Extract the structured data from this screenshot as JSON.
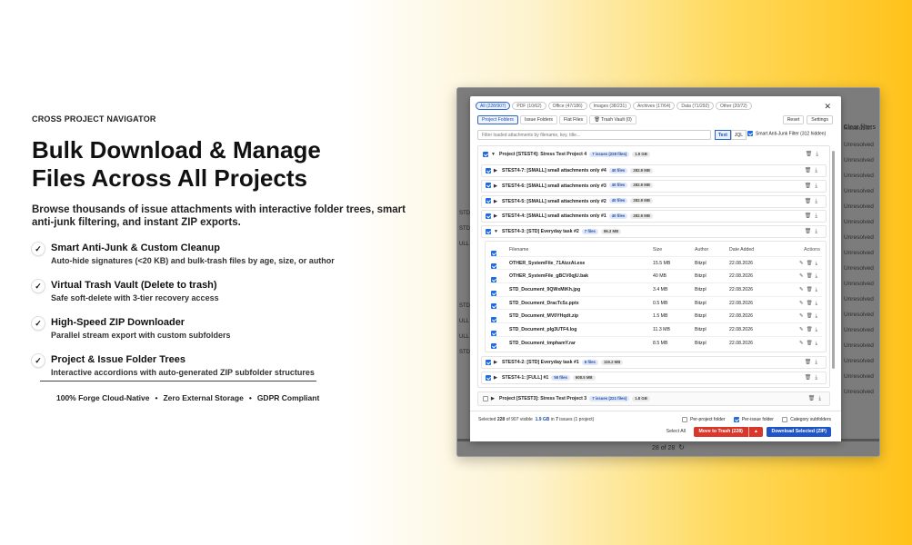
{
  "hero": {
    "eyebrow": "CROSS PROJECT NAVIGATOR",
    "headline_1": "Bulk Download & Manage",
    "headline_2": "Files Across All Projects",
    "subhead": "Browse thousands of issue attachments with interactive folder trees, smart anti-junk filtering, and instant ZIP exports.",
    "features": [
      {
        "title": "Smart Anti-Junk & Custom Cleanup",
        "desc": "Auto-hide signatures (<20 KB) and bulk-trash files by age, size, or author"
      },
      {
        "title": "Virtual Trash Vault (Delete to trash)",
        "desc": "Safe soft-delete with 3-tier recovery access"
      },
      {
        "title": "High-Speed ZIP Downloader",
        "desc": "Parallel stream export with custom subfolders"
      },
      {
        "title": "Project & Issue Folder Trees",
        "desc": "Interactive accordions with auto-generated ZIP subfolder structures"
      }
    ],
    "footer_items": [
      "100% Forge Cloud-Native",
      "Zero External Storage",
      "GDPR Compliant"
    ]
  },
  "background_app": {
    "clear_filters": "Clear filters",
    "resolution_header": "Resolution",
    "rows": [
      "Unresolved",
      "Unresolved",
      "Unresolved",
      "Unresolved",
      "Unresolved",
      "Unresolved",
      "Unresolved",
      "Unresolved",
      "Unresolved",
      "Unresolved",
      "Unresolved",
      "Unresolved",
      "Unresolved",
      "Unresolved",
      "Unresolved",
      "Unresolved",
      "Unresolved"
    ],
    "left_rows": [
      "J",
      "",
      "",
      "",
      "",
      "",
      "STD",
      "STD",
      "ULL",
      "",
      "",
      "",
      "STD",
      "ULL",
      "ULL",
      "STD",
      "",
      "STD"
    ],
    "pager": "28 of 28"
  },
  "modal": {
    "type_filters": [
      {
        "label": "All (228/907)",
        "active": true
      },
      {
        "label": "PDF (10/62)",
        "active": false
      },
      {
        "label": "Office (47/186)",
        "active": false
      },
      {
        "label": "Images (38/231)",
        "active": false
      },
      {
        "label": "Archives (17/64)",
        "active": false
      },
      {
        "label": "Data (71/292)",
        "active": false
      },
      {
        "label": "Other (20/72)",
        "active": false
      }
    ],
    "view_tabs": [
      {
        "label": "Project Folders",
        "active": true
      },
      {
        "label": "Issue Folders",
        "active": false
      },
      {
        "label": "Flat Files",
        "active": false
      },
      {
        "label": "Trash Vault (0)",
        "active": false
      }
    ],
    "reset_label": "Reset",
    "settings_label": "Settings",
    "filter_placeholder": "Filter loaded attachments by filename, key, title...",
    "mode_text": "Text",
    "mode_jql": "JQL",
    "antijunk_label": "Smart Anti-Junk Filter (312 hidden)",
    "project_1": {
      "title": "Project [STEST4]: Stress Test Project 4",
      "issues_badge": "7 issues (228 files)",
      "size_badge": "1.9 GB"
    },
    "issues": [
      {
        "title": "STEST4-7: [SMALL] small attachments only #4",
        "files": "40 files",
        "size": "282.9 MB",
        "open": false
      },
      {
        "title": "STEST4-6: [SMALL] small attachments only #3",
        "files": "40 files",
        "size": "282.9 MB",
        "open": false
      },
      {
        "title": "STEST4-5: [SMALL] small attachments only #2",
        "files": "40 files",
        "size": "282.9 MB",
        "open": false
      },
      {
        "title": "STEST4-4: [SMALL] small attachments only #1",
        "files": "40 files",
        "size": "282.9 MB",
        "open": false
      },
      {
        "title": "STEST4-3: [STD] Everyday task #2",
        "files": "7 files",
        "size": "86.3 MB",
        "open": true
      }
    ],
    "file_columns": {
      "name": "Filename",
      "size": "Size",
      "author": "Author",
      "date": "Date Added",
      "actions": "Actions"
    },
    "files": [
      {
        "name": "OTHER_SystemFile_71AtzzAt.exe",
        "size": "15.5 MB",
        "author": "Bitzpl",
        "date": "22.08.2026"
      },
      {
        "name": "OTHER_SystemFile_gBCV0qjU.bak",
        "size": "40 MB",
        "author": "Bitzpl",
        "date": "22.08.2026"
      },
      {
        "name": "STD_Document_9QWxMiKh.jpg",
        "size": "3.4 MB",
        "author": "Bitzpl",
        "date": "22.08.2026"
      },
      {
        "name": "STD_Document_DracTc5z.pptx",
        "size": "0.5 MB",
        "author": "Bitzpl",
        "date": "22.08.2026"
      },
      {
        "name": "STD_Document_MV0YHqdt.zip",
        "size": "1.5 MB",
        "author": "Bitzpl",
        "date": "22.08.2026"
      },
      {
        "name": "STD_Document_pIg3UTF4.log",
        "size": "11.3 MB",
        "author": "Bitzpl",
        "date": "22.08.2026"
      },
      {
        "name": "STD_Document_tmphamY.rar",
        "size": "8.5 MB",
        "author": "Bitzpl",
        "date": "22.08.2026"
      }
    ],
    "issues_after": [
      {
        "title": "STEST4-2: [STD] Everyday task #1",
        "files": "6 files",
        "size": "119.2 MB"
      },
      {
        "title": "STEST4-1: [FULL] #1",
        "files": "55 files",
        "size": "608.5 MB"
      }
    ],
    "project_2": {
      "title": "Project [STEST3]: Stress Test Project 3",
      "issues_badge": "7 issues (221 files)",
      "size_badge": "1.8 GB"
    },
    "footer": {
      "selected_prefix": "Selected",
      "selected_count": "228",
      "selected_mid": "of 907 visible",
      "selected_size": "1.9 GB",
      "selected_in": "in",
      "selected_issues": "7",
      "selected_suffix": "issues (1 project)",
      "opt_per_project": "Per-project folder",
      "opt_per_issue": "Per-issue folder",
      "opt_category": "Category subfolders",
      "select_all": "Select All",
      "move_trash": "Move to Trash (228)",
      "download": "Download Selected (ZIP)"
    }
  }
}
